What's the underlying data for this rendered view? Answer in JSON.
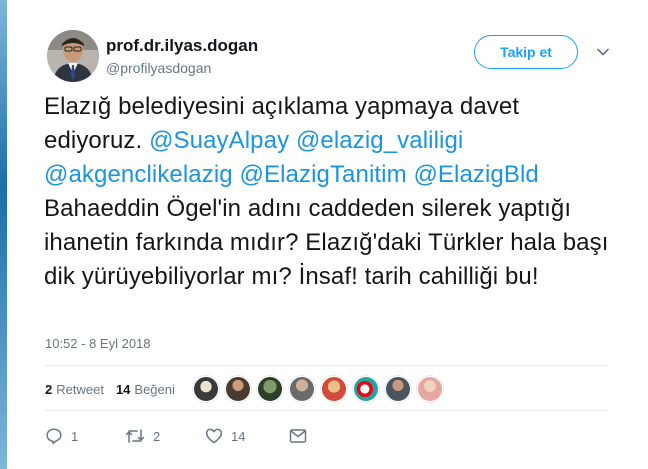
{
  "tweet": {
    "user": {
      "name": "prof.dr.ilyas.dogan",
      "handle": "@profilyasdogan"
    },
    "follow_label": "Takip et",
    "text": {
      "part1": "Elazığ belediyesini açıklama yapmaya davet ediyoruz. ",
      "mention1": "@SuayAlpay",
      "mention2": "@elazig_valiligi",
      "mention3": "@akgenclikelazig",
      "mention4": "@ElazigTanitim",
      "mention5": "@ElazigBld",
      "part2": "Bahaeddin Ögel'in adını caddeden silerek yaptığı ihanetin farkında mıdır? Elazığ'daki Türkler hala başı dik yürüyebiliyorlar mı? İnsaf! tarih cahilliği bu!"
    },
    "timestamp": "10:52 - 8 Eyl 2018",
    "stats": {
      "retweets_count": "2",
      "retweets_label": "Retweet",
      "likes_count": "14",
      "likes_label": "Beğeni"
    },
    "actions": {
      "reply_count": "1",
      "retweet_count": "2",
      "like_count": "14"
    },
    "colors": {
      "accent": "#1da1f2",
      "mention": "#1b95e0",
      "muted": "#657786"
    }
  }
}
